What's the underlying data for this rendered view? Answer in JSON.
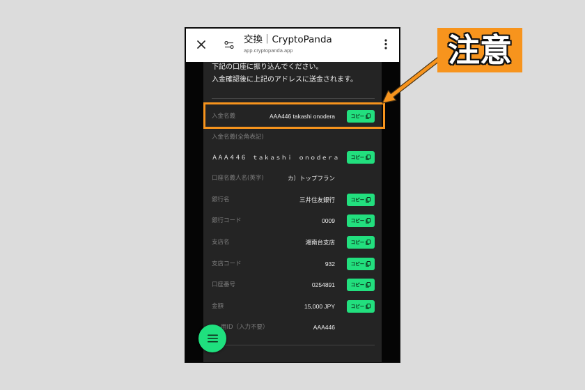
{
  "page": {
    "background": "#dcdcdc"
  },
  "browser": {
    "title": "交換｜CryptoPanda",
    "url": "app.cryptopanda.app",
    "close_icon": "close-icon",
    "settings_icon": "tune-icon",
    "menu_icon": "more-vert-icon"
  },
  "instructions": {
    "line1": "下記の口座に振り込んでください。",
    "line2": "入金確認後に上記のアドレスに送金されます。"
  },
  "details": {
    "copy_label": "コピー",
    "copy_icon": "copy-icon",
    "rows": [
      {
        "label": "入金名義",
        "value": "AAA446 takashi onodera",
        "copyable": true,
        "highlighted": true
      },
      {
        "label": "入金名義(全角表記)",
        "value": "ＡＡＡ４４６　ｔａｋａｓｈｉ　ｏｎｏｄｅｒａ",
        "copyable": true
      },
      {
        "label": "口座名義人名(英字)",
        "value": "カ）トップフラン",
        "copyable": false
      },
      {
        "label": "銀行名",
        "value": "三井住友銀行",
        "copyable": true
      },
      {
        "label": "銀行コード",
        "value": "0009",
        "copyable": true
      },
      {
        "label": "支店名",
        "value": "湘南台支店",
        "copyable": true
      },
      {
        "label": "支店コード",
        "value": "932",
        "copyable": true
      },
      {
        "label": "口座番号",
        "value": "0254891",
        "copyable": true
      },
      {
        "label": "金額",
        "value": "15,000 JPY",
        "copyable": true
      },
      {
        "label": "用ID（入力不要）",
        "value": "AAA446",
        "copyable": false
      }
    ]
  },
  "fab": {
    "icon": "menu-icon"
  },
  "annotation": {
    "text": "注意",
    "color": "#f7941d",
    "text_color": "#ffffff",
    "arrow_icon": "arrow-icon"
  },
  "colors": {
    "accent": "#22df7e",
    "panel": "#242424",
    "highlight": "#f7941d"
  }
}
